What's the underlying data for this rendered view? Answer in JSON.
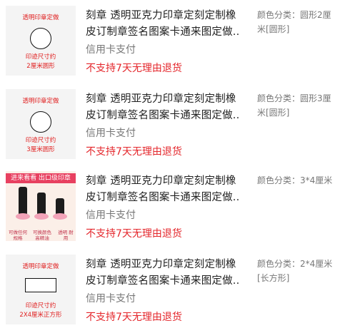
{
  "items": [
    {
      "title_line1": "刻章 透明亚克力印章定刻定制橡",
      "title_line2": "皮订制章签名图案卡通来图定做...",
      "payment": "信用卡支付",
      "refund": "不支持7天无理由退货",
      "sku": "颜色分类：圆形2厘米[圆形]",
      "thumb_top": "透明印章定做",
      "thumb_bottom_line1": "印迹尺寸约",
      "thumb_bottom_line2": "2厘米圆形",
      "thumb_shape": "circle"
    },
    {
      "title_line1": "刻章 透明亚克力印章定刻定制橡",
      "title_line2": "皮订制章签名图案卡通来图定做...",
      "payment": "信用卡支付",
      "refund": "不支持7天无理由退货",
      "sku": "颜色分类：圆形3厘米[圆形]",
      "thumb_top": "透明印章定做",
      "thumb_bottom_line1": "印迹尺寸约",
      "thumb_bottom_line2": "3厘米圆形",
      "thumb_shape": "circle"
    },
    {
      "title_line1": "刻章 透明亚克力印章定刻定制橡",
      "title_line2": "皮订制章签名图案卡通来图定做...",
      "payment": "信用卡支付",
      "refund": "不支持7天无理由退货",
      "sku": "颜色分类：3*4厘米",
      "thumb_banner": "进来看看 出口级印章",
      "thumb_caption_1": "可做任何规格",
      "thumb_caption_2": "可换颜色 高精油",
      "thumb_caption_3": "透明 耐用"
    },
    {
      "title_line1": "刻章 透明亚克力印章定刻定制橡",
      "title_line2": "皮订制章签名图案卡通来图定做...",
      "payment": "信用卡支付",
      "refund": "不支持7天无理由退货",
      "sku": "颜色分类：2*4厘米[长方形]",
      "thumb_top": "透明印章定做",
      "thumb_bottom_line1": "印迹尺寸约",
      "thumb_bottom_line2": "2X4厘米正方形",
      "thumb_shape": "rect"
    }
  ],
  "colors": {
    "refund": "#e4262b",
    "muted": "#777777",
    "thumb_text": "#e02020"
  }
}
